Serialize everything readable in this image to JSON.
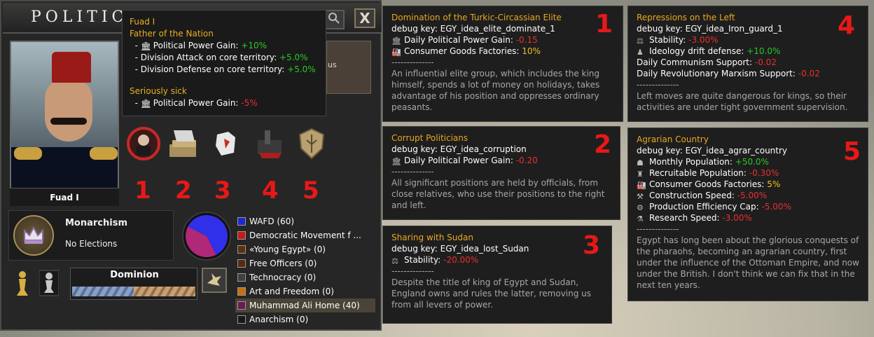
{
  "window": {
    "title": "POLITICA",
    "close_label": "X",
    "search_icon": "magnifier-icon"
  },
  "leader": {
    "name": "Fuad I",
    "tooltip": {
      "name": "Fuad I",
      "trait1": "Father of the Nation",
      "trait1_lines": [
        {
          "label": "Political Power Gain:",
          "value": "+10%",
          "color": "green"
        },
        {
          "label": "Division Attack on core territory:",
          "value": "+5.0%",
          "color": "green"
        },
        {
          "label": "Division Defense on core territory:",
          "value": "+5.0%",
          "color": "green"
        }
      ],
      "trait2": "Seriously sick",
      "trait2_lines": [
        {
          "label": "Political Power Gain:",
          "value": "-5%",
          "color": "red"
        }
      ]
    }
  },
  "partial_label": "us",
  "ideas": {
    "icons": [
      "elite-portrait-icon",
      "money-hand-icon",
      "torn-map-icon",
      "chained-hammer-icon",
      "wheat-shield-icon"
    ],
    "numbers": [
      "1",
      "2",
      "3",
      "4",
      "5"
    ]
  },
  "ideology": {
    "name": "Monarchism",
    "elections": "No Elections"
  },
  "parties": [
    {
      "name": "WAFD (60)",
      "color": "#1a2ad0"
    },
    {
      "name": "Democratic Movement f ...",
      "color": "#c81818"
    },
    {
      "name": "«Young Egypt» (0)",
      "color": "#5a3010"
    },
    {
      "name": "Free Officers (0)",
      "color": "#5a2a10"
    },
    {
      "name": "Technocracy (0)",
      "color": "#404040"
    },
    {
      "name": "Art and Freedom (0)",
      "color": "#c87010"
    },
    {
      "name": "Muhammad Ali Home (40)",
      "color": "#6a1a50"
    },
    {
      "name": "Anarchism (0)",
      "color": "#181818"
    }
  ],
  "pie_data": [
    {
      "party": "WAFD",
      "value": 60,
      "color": "#3030e8"
    },
    {
      "party": "Muhammad Ali Home",
      "value": 40,
      "color": "#b02878"
    }
  ],
  "dominion": {
    "label": "Dominion",
    "button_icon": "dove-icon"
  },
  "tooltips": [
    {
      "num": "1",
      "title": "Domination of the Turkic-Circassian Elite",
      "debug": "debug key: EGY_idea_elite_dominate_1",
      "lines": [
        {
          "icon": "pp-icon",
          "label": "Daily Political Power Gain:",
          "value": "-0.15",
          "color": "red"
        },
        {
          "icon": "factory-icon",
          "label": "Consumer Goods Factories:",
          "value": "10%",
          "color": "gold"
        }
      ],
      "sep": "--------------",
      "desc": "An influential elite group, which includes the king himself, spends a lot of money on holidays, takes advantage of his position and oppresses ordinary peasants."
    },
    {
      "num": "2",
      "title": "Corrupt Politicians",
      "debug": "debug key: EGY_idea_corruption",
      "lines": [
        {
          "icon": "pp-icon",
          "label": "Daily Political Power Gain:",
          "value": "-0.20",
          "color": "red"
        }
      ],
      "sep": "--------------",
      "desc": "All significant positions are held by officials, from close relatives, who use their positions to the right and left."
    },
    {
      "num": "3",
      "title": "Sharing with Sudan",
      "debug": "debug key: EGY_idea_lost_Sudan",
      "lines": [
        {
          "icon": "scale-icon",
          "label": "Stability:",
          "value": "-20.00%",
          "color": "red"
        }
      ],
      "sep": "--------------",
      "desc": "Despite the title of king of Egypt and Sudan, England owns and rules the latter, removing us from all levers of power."
    },
    {
      "num": "4",
      "title": "Repressions on the Left",
      "debug": "debug key: EGY_idea_Iron_guard_1",
      "lines": [
        {
          "icon": "scale-icon",
          "label": "Stability:",
          "value": "-3.00%",
          "color": "red"
        },
        {
          "icon": "ideology-icon",
          "label": "Ideology drift defense:",
          "value": "+10.0%",
          "color": "green"
        },
        {
          "icon": "",
          "label": "Daily Communism Support:",
          "value": "-0.02",
          "color": "red"
        },
        {
          "icon": "",
          "label": "Daily Revolutionary Marxism Support:",
          "value": "-0.02",
          "color": "red"
        }
      ],
      "sep": "--------------",
      "desc": "Left moves are quite dangerous for kings, so their activities are under tight government supervision."
    },
    {
      "num": "5",
      "title": "Agrarian Country",
      "debug": "debug key: EGY_idea_agrar_country",
      "lines": [
        {
          "icon": "population-icon",
          "label": "Monthly Population:",
          "value": "+50.0%",
          "color": "green"
        },
        {
          "icon": "recruit-icon",
          "label": "Recruitable Population:",
          "value": "-0.30%",
          "color": "red"
        },
        {
          "icon": "factory-icon",
          "label": "Consumer Goods Factories:",
          "value": "5%",
          "color": "gold"
        },
        {
          "icon": "construction-icon",
          "label": "Construction Speed:",
          "value": "-5.00%",
          "color": "red"
        },
        {
          "icon": "production-icon",
          "label": "Production Efficiency Cap:",
          "value": "-5.00%",
          "color": "red"
        },
        {
          "icon": "research-icon",
          "label": "Research Speed:",
          "value": "-3.00%",
          "color": "red"
        }
      ],
      "sep": "--------------",
      "desc": "Egypt has long been about the glorious conquests of the pharaohs, becoming an agrarian country, first under the influence of the Ottoman Empire, and now under the British. I don't think we can fix that in the next ten years."
    }
  ]
}
